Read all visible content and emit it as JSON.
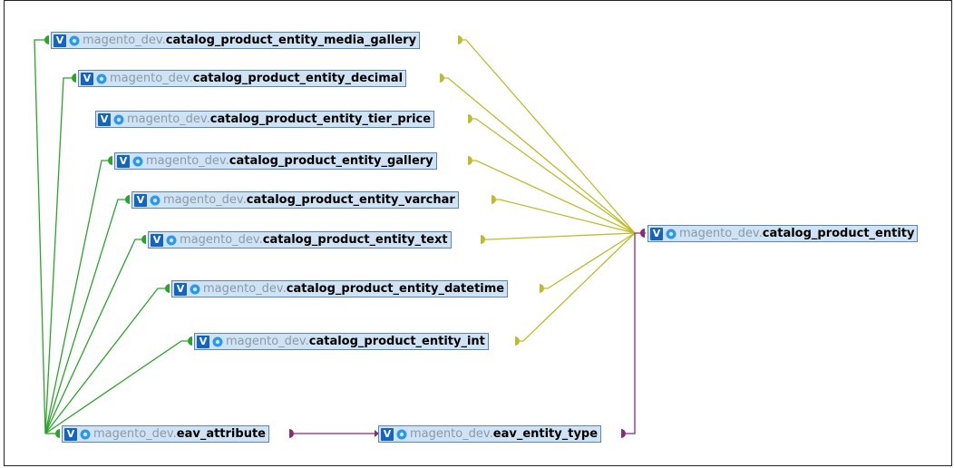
{
  "colors": {
    "node_bg": "#cfe3f5",
    "node_border": "#5a87b8",
    "view_badge": "#1565c0",
    "schema_text": "#8a9aa8",
    "edge_green": "#2aa52a",
    "edge_olive": "#bdbd2a",
    "edge_purple": "#8a2a78"
  },
  "badge_label": "V",
  "nodes": [
    {
      "id": "media_gallery",
      "schema": "magento_dev.",
      "table": "catalog_product_entity_media_gallery"
    },
    {
      "id": "decimal",
      "schema": "magento_dev.",
      "table": "catalog_product_entity_decimal"
    },
    {
      "id": "tier_price",
      "schema": "magento_dev.",
      "table": "catalog_product_entity_tier_price"
    },
    {
      "id": "gallery",
      "schema": "magento_dev.",
      "table": "catalog_product_entity_gallery"
    },
    {
      "id": "varchar",
      "schema": "magento_dev.",
      "table": "catalog_product_entity_varchar"
    },
    {
      "id": "text",
      "schema": "magento_dev.",
      "table": "catalog_product_entity_text"
    },
    {
      "id": "datetime",
      "schema": "magento_dev.",
      "table": "catalog_product_entity_datetime"
    },
    {
      "id": "int",
      "schema": "magento_dev.",
      "table": "catalog_product_entity_int"
    },
    {
      "id": "eav_attribute",
      "schema": "magento_dev.",
      "table": "eav_attribute"
    },
    {
      "id": "eav_entity_type",
      "schema": "magento_dev.",
      "table": "eav_entity_type"
    },
    {
      "id": "product_entity",
      "schema": "magento_dev.",
      "table": "catalog_product_entity"
    }
  ]
}
